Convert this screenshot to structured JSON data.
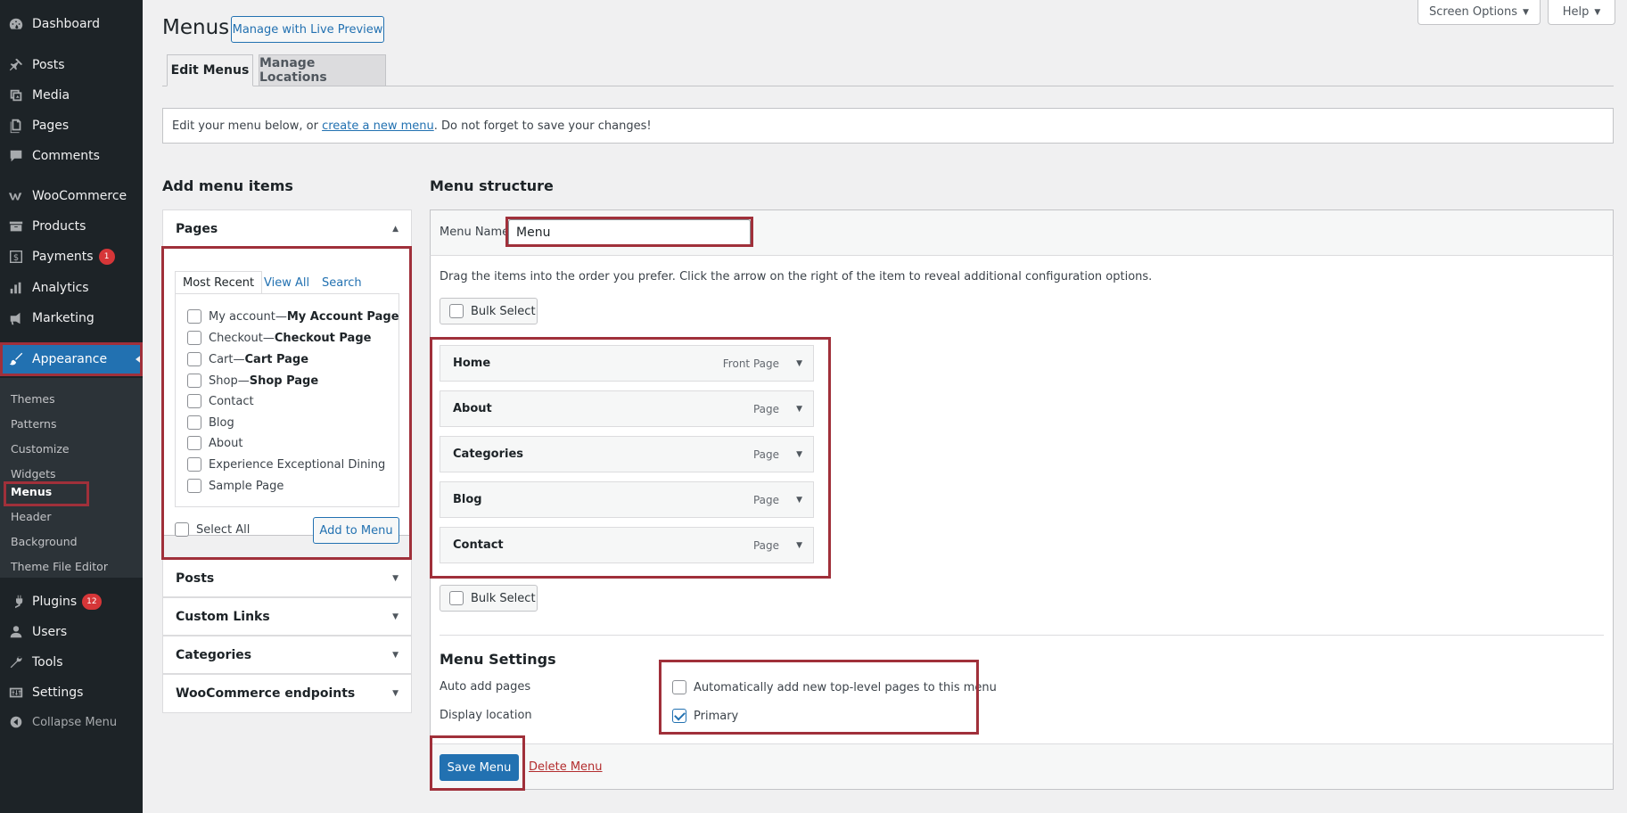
{
  "sidebar": {
    "items": [
      {
        "label": "Dashboard",
        "icon": "dashboard-icon"
      },
      {
        "label": "Posts",
        "icon": "pin-icon"
      },
      {
        "label": "Media",
        "icon": "media-icon"
      },
      {
        "label": "Pages",
        "icon": "page-icon"
      },
      {
        "label": "Comments",
        "icon": "comment-icon"
      },
      {
        "label": "WooCommerce",
        "icon": "woocommerce-icon"
      },
      {
        "label": "Products",
        "icon": "archive-icon"
      },
      {
        "label": "Payments",
        "icon": "dollar-icon",
        "badge": "1"
      },
      {
        "label": "Analytics",
        "icon": "bar-chart-icon"
      },
      {
        "label": "Marketing",
        "icon": "megaphone-icon"
      },
      {
        "label": "Appearance",
        "icon": "brush-icon"
      },
      {
        "label": "Plugins",
        "icon": "plug-icon",
        "badge": "12"
      },
      {
        "label": "Users",
        "icon": "user-icon"
      },
      {
        "label": "Tools",
        "icon": "wrench-icon"
      },
      {
        "label": "Settings",
        "icon": "sliders-icon"
      }
    ],
    "submenu": [
      "Themes",
      "Patterns",
      "Customize",
      "Widgets",
      "Menus",
      "Header",
      "Background",
      "Theme File Editor"
    ],
    "collapse_label": "Collapse Menu"
  },
  "header": {
    "title": "Menus",
    "live_preview_label": "Manage with Live Preview",
    "screen_options_label": "Screen Options",
    "help_label": "Help"
  },
  "tabs": [
    "Edit Menus",
    "Manage Locations"
  ],
  "notice": {
    "before": "Edit your menu below, or ",
    "link": "create a new menu",
    "after": ". Do not forget to save your changes!"
  },
  "add_items": {
    "heading": "Add menu items",
    "pages_panel": {
      "title": "Pages",
      "subtabs": [
        "Most Recent",
        "View All",
        "Search"
      ],
      "items": [
        {
          "name": "My account",
          "sep": " — ",
          "tag": "My Account Page"
        },
        {
          "name": "Checkout",
          "sep": " — ",
          "tag": "Checkout Page"
        },
        {
          "name": "Cart",
          "sep": " — ",
          "tag": "Cart Page"
        },
        {
          "name": "Shop",
          "sep": " — ",
          "tag": "Shop Page"
        },
        {
          "name": "Contact",
          "sep": "",
          "tag": ""
        },
        {
          "name": "Blog",
          "sep": "",
          "tag": ""
        },
        {
          "name": "About",
          "sep": "",
          "tag": ""
        },
        {
          "name": "Experience Exceptional Dining",
          "sep": "",
          "tag": ""
        },
        {
          "name": "Sample Page",
          "sep": "",
          "tag": ""
        }
      ],
      "select_all_label": "Select All",
      "add_button_label": "Add to Menu"
    },
    "other_panels": [
      "Posts",
      "Custom Links",
      "Categories",
      "WooCommerce endpoints"
    ]
  },
  "structure": {
    "heading": "Menu structure",
    "menu_name_label": "Menu Name",
    "menu_name_value": "Menu",
    "instructions": "Drag the items into the order you prefer. Click the arrow on the right of the item to reveal additional configuration options.",
    "bulk_select_label": "Bulk Select",
    "items": [
      {
        "title": "Home",
        "type": "Front Page"
      },
      {
        "title": "About",
        "type": "Page"
      },
      {
        "title": "Categories",
        "type": "Page"
      },
      {
        "title": "Blog",
        "type": "Page"
      },
      {
        "title": "Contact",
        "type": "Page"
      }
    ]
  },
  "settings": {
    "heading": "Menu Settings",
    "auto_add_label": "Auto add pages",
    "auto_add_option": "Automatically add new top-level pages to this menu",
    "display_location_label": "Display location",
    "location_option": "Primary",
    "location_checked": true,
    "auto_add_checked": false
  },
  "footer": {
    "save_label": "Save Menu",
    "delete_label": "Delete Menu"
  },
  "colors": {
    "sidebar_bg": "#1d2327",
    "accent": "#2271b1",
    "highlight": "#a0303a",
    "danger": "#b32d2e"
  }
}
